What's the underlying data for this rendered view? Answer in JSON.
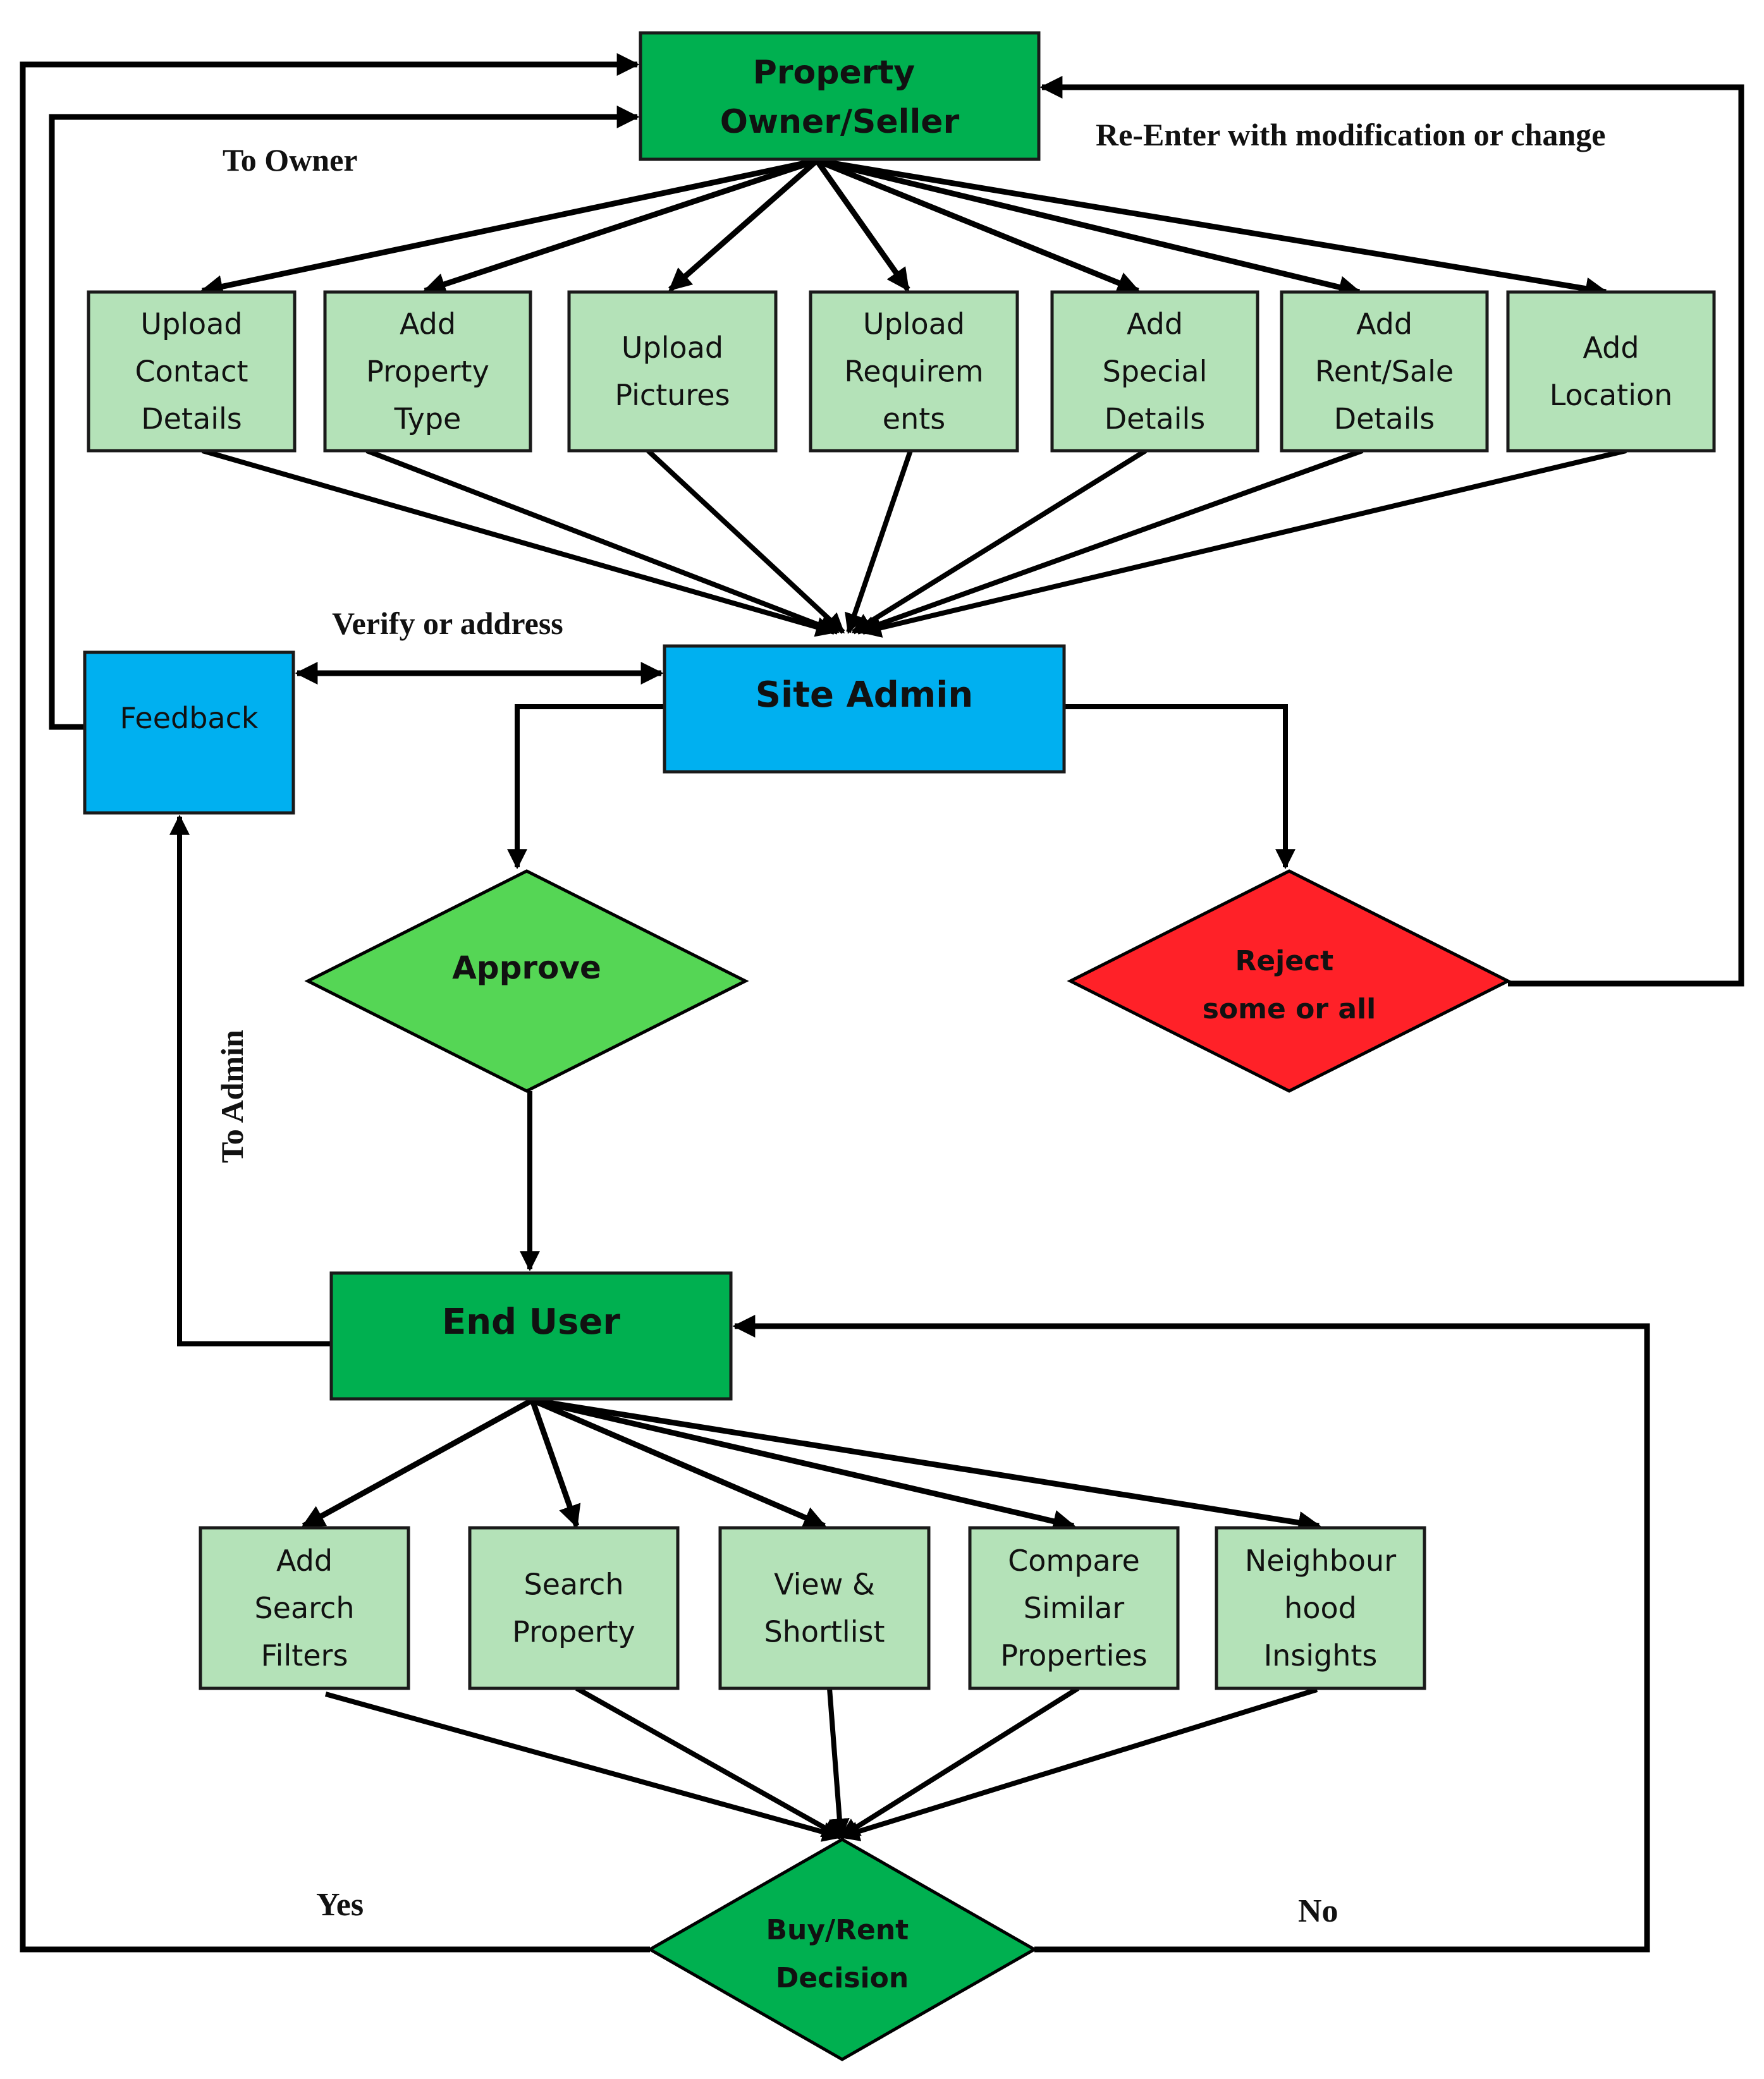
{
  "diagram": {
    "colors": {
      "dark_green": "#00b050",
      "light_green": "#b4e2b8",
      "blue": "#00b0f0",
      "approve_green": "#55d655",
      "reject_red": "#ff2128",
      "line": "#000000"
    },
    "nodes": {
      "owner": {
        "lines": [
          "Property",
          "Owner/Seller"
        ]
      },
      "site_admin": {
        "lines": [
          "Site Admin"
        ]
      },
      "feedback": {
        "lines": [
          "Feedback"
        ]
      },
      "approve": {
        "lines": [
          "Approve"
        ]
      },
      "reject": {
        "lines": [
          "Reject",
          "some or all"
        ]
      },
      "end_user": {
        "lines": [
          "End User"
        ]
      },
      "decision": {
        "lines": [
          "Buy/Rent",
          "Decision"
        ]
      }
    },
    "owner_tasks": [
      {
        "lines": [
          "Upload",
          "Contact",
          "Details"
        ]
      },
      {
        "lines": [
          "Add",
          "Property",
          "Type"
        ]
      },
      {
        "lines": [
          "Upload",
          "Pictures"
        ]
      },
      {
        "lines": [
          "Upload",
          "Requirem",
          "ents"
        ]
      },
      {
        "lines": [
          "Add",
          "Special",
          "Details"
        ]
      },
      {
        "lines": [
          "Add",
          "Rent/Sale",
          "Details"
        ]
      },
      {
        "lines": [
          "Add",
          "Location"
        ]
      }
    ],
    "user_tasks": [
      {
        "lines": [
          "Add",
          "Search",
          "Filters"
        ]
      },
      {
        "lines": [
          "Search",
          "Property"
        ]
      },
      {
        "lines": [
          "View &",
          "Shortlist"
        ]
      },
      {
        "lines": [
          "Compare",
          "Similar",
          "Properties"
        ]
      },
      {
        "lines": [
          "Neighbour",
          "hood",
          "Insights"
        ]
      }
    ],
    "edge_labels": {
      "to_owner": "To Owner",
      "re_enter": "Re-Enter with modification or change",
      "verify": "Verify or address",
      "to_admin": "To Admin",
      "yes": "Yes",
      "no": "No"
    }
  }
}
